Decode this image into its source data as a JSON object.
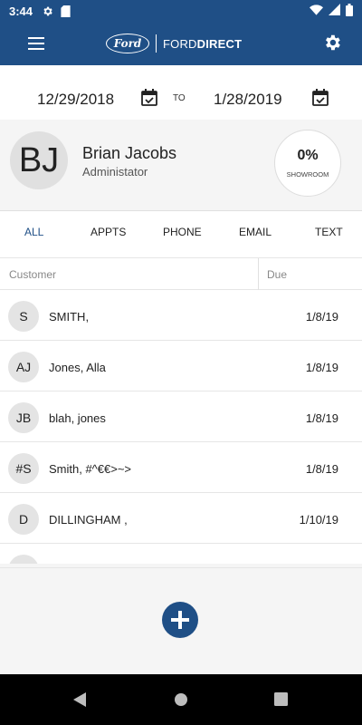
{
  "status_bar": {
    "time": "3:44",
    "icons": [
      "settings-icon",
      "sd-card-icon",
      "wifi-icon",
      "signal-icon",
      "battery-icon"
    ]
  },
  "app_bar": {
    "menu_icon": "hamburger-menu-icon",
    "brand_oval": "Ford",
    "brand_ford": "FORD",
    "brand_direct": "DIRECT",
    "settings_icon": "gear-icon"
  },
  "date_range": {
    "start": "12/29/2018",
    "to_label": "TO",
    "end": "1/28/2019",
    "calendar_icon": "calendar-check-icon"
  },
  "profile": {
    "initials": "BJ",
    "name": "Brian Jacobs",
    "role": "Administator",
    "showroom_percent": "0%",
    "showroom_label": "SHOWROOM"
  },
  "tabs": [
    {
      "label": "ALL",
      "active": true
    },
    {
      "label": "APPTS",
      "active": false
    },
    {
      "label": "PHONE",
      "active": false
    },
    {
      "label": "EMAIL",
      "active": false
    },
    {
      "label": "TEXT",
      "active": false
    }
  ],
  "table": {
    "columns": {
      "customer": "Customer",
      "due": "Due"
    },
    "rows": [
      {
        "initials": "S",
        "name": "SMITH,",
        "due": "1/8/19"
      },
      {
        "initials": "AJ",
        "name": "Jones, Alla",
        "due": "1/8/19"
      },
      {
        "initials": "JB",
        "name": "blah, jones",
        "due": "1/8/19"
      },
      {
        "initials": "#S",
        "name": "Smith, #^€€>~>",
        "due": "1/8/19"
      },
      {
        "initials": "D",
        "name": "DILLINGHAM ,",
        "due": "1/10/19"
      },
      {
        "initials": "",
        "name": "",
        "due": ""
      }
    ]
  },
  "fab": {
    "icon": "plus-icon"
  },
  "nav_bar": {
    "icons": [
      "back-icon",
      "home-icon",
      "recents-icon"
    ]
  },
  "colors": {
    "primary": "#1f4f86",
    "background": "#f5f5f5"
  }
}
